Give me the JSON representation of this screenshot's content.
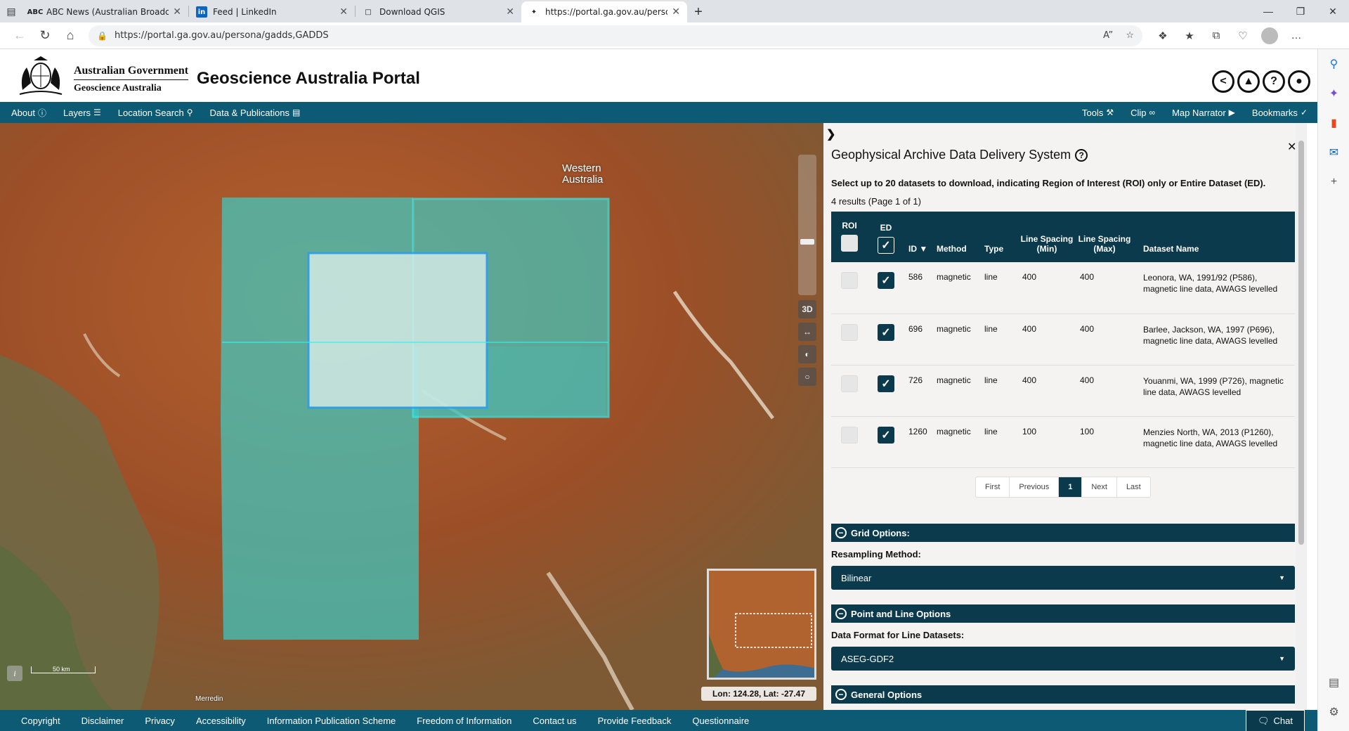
{
  "browser": {
    "tabs": [
      {
        "title": "ABC News (Australian Broadcasti",
        "icon": "abc-icon",
        "active": false
      },
      {
        "title": "Feed | LinkedIn",
        "icon": "linkedin-icon",
        "active": false
      },
      {
        "title": "Download QGIS",
        "icon": "page-icon",
        "active": false
      },
      {
        "title": "https://portal.ga.gov.au/persona",
        "icon": "ga-icon",
        "active": true
      }
    ],
    "url": "https://portal.ga.gov.au/persona/gadds,GADDS"
  },
  "header": {
    "gov_line1": "Australian Government",
    "gov_line2": "Geoscience Australia",
    "title": "Geoscience Australia Portal"
  },
  "nav": {
    "left": [
      {
        "label": "About"
      },
      {
        "label": "Layers"
      },
      {
        "label": "Location Search"
      },
      {
        "label": "Data & Publications"
      }
    ],
    "right": [
      {
        "label": "Tools"
      },
      {
        "label": "Clip"
      },
      {
        "label": "Map Narrator"
      },
      {
        "label": "Bookmarks"
      }
    ]
  },
  "map": {
    "region_label_line1": "Western",
    "region_label_line2": "Australia",
    "controls": [
      "3D",
      "↔",
      "◐",
      "○"
    ],
    "scale_label": "50 km",
    "town_label": "Merredin",
    "coordinates": "Lon: 124.28, Lat: -27.47"
  },
  "panel": {
    "title": "Geophysical Archive Data Delivery System",
    "instructions": "Select up to 20 datasets to download, indicating Region of Interest (ROI) only or Entire Dataset (ED).",
    "results_text": "4 results (Page 1 of 1)",
    "columns": {
      "roi": "ROI",
      "ed": "ED",
      "id": "ID",
      "method": "Method",
      "type": "Type",
      "line_min": "Line Spacing (Min)",
      "line_max": "Line Spacing (Max)",
      "dataset": "Dataset Name"
    },
    "rows": [
      {
        "id": "586",
        "method": "magnetic",
        "type": "line",
        "min": "400",
        "max": "400",
        "name": "Leonora, WA, 1991/92 (P586), magnetic line data, AWAGS levelled",
        "roi": false,
        "ed": true
      },
      {
        "id": "696",
        "method": "magnetic",
        "type": "line",
        "min": "400",
        "max": "400",
        "name": "Barlee, Jackson, WA, 1997 (P696), magnetic line data, AWAGS levelled",
        "roi": false,
        "ed": true
      },
      {
        "id": "726",
        "method": "magnetic",
        "type": "line",
        "min": "400",
        "max": "400",
        "name": "Youanmi, WA, 1999 (P726), magnetic line data, AWAGS levelled",
        "roi": false,
        "ed": true
      },
      {
        "id": "1260",
        "method": "magnetic",
        "type": "line",
        "min": "100",
        "max": "100",
        "name": "Menzies North, WA, 2013 (P1260), magnetic line data, AWAGS levelled",
        "roi": false,
        "ed": true
      }
    ],
    "pagination": [
      "First",
      "Previous",
      "1",
      "Next",
      "Last"
    ],
    "grid_options": "Grid Options:",
    "resampling_label": "Resampling Method:",
    "resampling_value": "Bilinear",
    "point_line_options": "Point and Line Options",
    "data_format_label": "Data Format for Line Datasets:",
    "data_format_value": "ASEG-GDF2",
    "general_options": "General Options"
  },
  "footer": {
    "links": [
      "Copyright",
      "Disclaimer",
      "Privacy",
      "Accessibility",
      "Information Publication Scheme",
      "Freedom of Information",
      "Contact us",
      "Provide Feedback",
      "Questionnaire"
    ],
    "chat": "Chat"
  },
  "colors": {
    "nav_bg": "#0d5a74",
    "panel_dark": "#0c3a4d",
    "overlay_teal": "#3fc9c2",
    "selection_blue": "#2a9df4"
  }
}
